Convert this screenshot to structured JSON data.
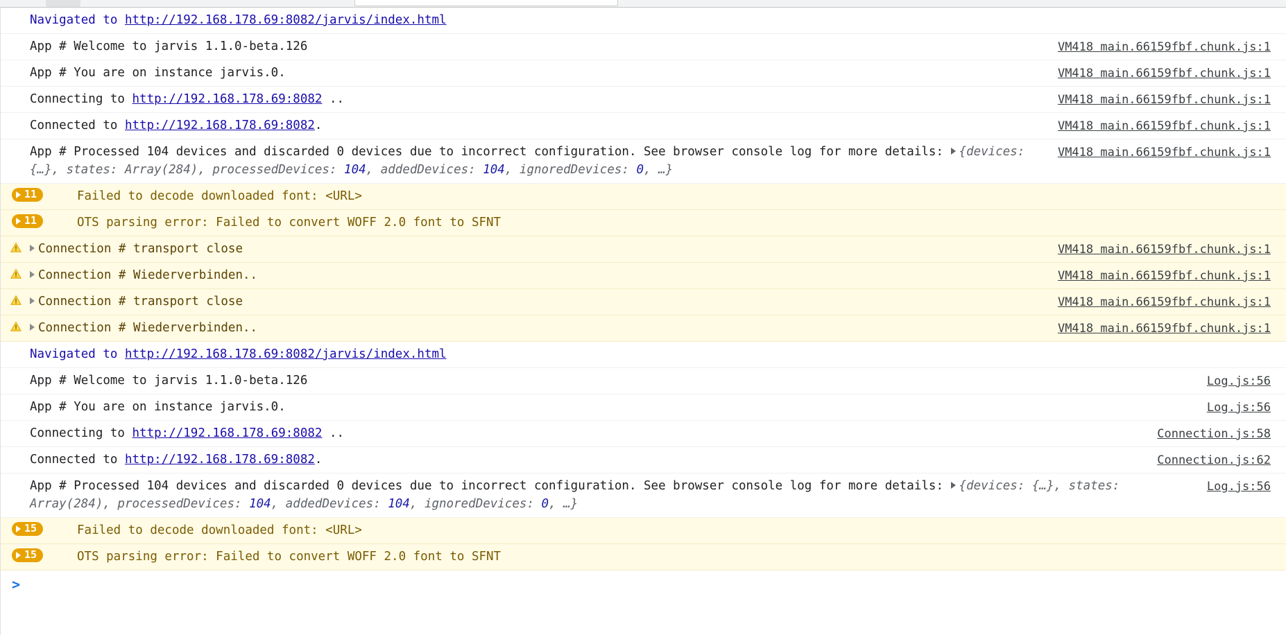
{
  "toolbar": {
    "filter_placeholder": "",
    "filter_value": ""
  },
  "console": {
    "prompt_chevron": ">",
    "prompt_value": "",
    "rows": [
      {
        "kind": "navigation",
        "nav_label": "Navigated to ",
        "url": "http://192.168.178.69:8082/jarvis/index.html",
        "source": ""
      },
      {
        "kind": "log",
        "text": "App # Welcome to jarvis 1.1.0-beta.126",
        "source": "VM418 main.66159fbf.chunk.js:1"
      },
      {
        "kind": "log",
        "text": "App # You are on instance jarvis.0.",
        "source": "VM418 main.66159fbf.chunk.js:1"
      },
      {
        "kind": "log-link",
        "pre": "Connecting to ",
        "url": "http://192.168.178.69:8082",
        "post": " ..",
        "source": "VM418 main.66159fbf.chunk.js:1"
      },
      {
        "kind": "log-link",
        "pre": "Connected to ",
        "url": "http://192.168.178.69:8082",
        "post": ".",
        "source": "VM418 main.66159fbf.chunk.js:1"
      },
      {
        "kind": "log-object",
        "text": "App # Processed 104 devices and discarded 0 devices due to incorrect configuration. See browser console log for more details: ",
        "object": {
          "open": "{",
          "parts": [
            {
              "key": "devices",
              "val": "{…}",
              "num": false
            },
            {
              "key": "states",
              "val": "Array(284)",
              "num": false
            },
            {
              "key": "processedDevices",
              "val": "104",
              "num": true
            },
            {
              "key": "addedDevices",
              "val": "104",
              "num": true
            },
            {
              "key": "ignoredDevices",
              "val": "0",
              "num": true
            }
          ],
          "tail": ", …}"
        },
        "source": "VM418 main.66159fbf.chunk.js:1"
      },
      {
        "kind": "group-count",
        "count": "11",
        "text": "Failed to decode downloaded font: <URL>",
        "source": ""
      },
      {
        "kind": "group-count",
        "count": "11",
        "text": "OTS parsing error: Failed to convert WOFF 2.0 font to SFNT",
        "source": ""
      },
      {
        "kind": "warning",
        "text": "Connection # transport close",
        "source": "VM418 main.66159fbf.chunk.js:1"
      },
      {
        "kind": "warning",
        "text": "Connection # Wiederverbinden..",
        "source": "VM418 main.66159fbf.chunk.js:1"
      },
      {
        "kind": "warning",
        "text": "Connection # transport close",
        "source": "VM418 main.66159fbf.chunk.js:1"
      },
      {
        "kind": "warning",
        "text": "Connection # Wiederverbinden..",
        "source": "VM418 main.66159fbf.chunk.js:1"
      },
      {
        "kind": "navigation",
        "nav_label": "Navigated to ",
        "url": "http://192.168.178.69:8082/jarvis/index.html",
        "source": ""
      },
      {
        "kind": "log",
        "text": "App # Welcome to jarvis 1.1.0-beta.126",
        "source": "Log.js:56"
      },
      {
        "kind": "log",
        "text": "App # You are on instance jarvis.0.",
        "source": "Log.js:56"
      },
      {
        "kind": "log-link",
        "pre": "Connecting to ",
        "url": "http://192.168.178.69:8082",
        "post": " ..",
        "source": "Connection.js:58"
      },
      {
        "kind": "log-link",
        "pre": "Connected to ",
        "url": "http://192.168.178.69:8082",
        "post": ".",
        "source": "Connection.js:62"
      },
      {
        "kind": "log-object",
        "text": "App # Processed 104 devices and discarded 0 devices due to incorrect configuration. See browser console log for more details: ",
        "object": {
          "open": "{",
          "parts": [
            {
              "key": "devices",
              "val": "{…}",
              "num": false
            },
            {
              "key": "states",
              "val": "Array(284)",
              "num": false
            },
            {
              "key": "processedDevices",
              "val": "104",
              "num": true
            },
            {
              "key": "addedDevices",
              "val": "104",
              "num": true
            },
            {
              "key": "ignoredDevices",
              "val": "0",
              "num": true
            }
          ],
          "tail": ", …}"
        },
        "source": "Log.js:56"
      },
      {
        "kind": "group-count",
        "count": "15",
        "text": "Failed to decode downloaded font: <URL>",
        "source": ""
      },
      {
        "kind": "group-count",
        "count": "15",
        "text": "OTS parsing error: Failed to convert WOFF 2.0 font to SFNT",
        "source": ""
      }
    ]
  },
  "colors": {
    "warn_bg": "#fffbe5",
    "warn_text": "#5c4303",
    "badge_bg": "#e8a200",
    "link": "#1a0dab",
    "prompt": "#1a73e8",
    "source": "#3c4043"
  }
}
